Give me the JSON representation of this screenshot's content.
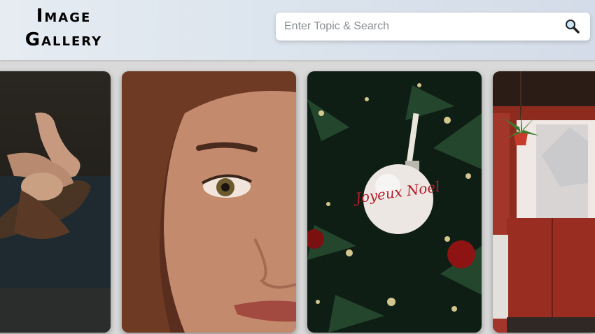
{
  "header": {
    "logo_line1": "Image",
    "logo_line2": "Gallery"
  },
  "search": {
    "placeholder": "Enter Topic & Search",
    "value": "",
    "icon": "magnifier-icon"
  },
  "gallery": {
    "images": [
      {
        "subject": "woman-lying-on-couch"
      },
      {
        "subject": "woman-face-closeup"
      },
      {
        "subject": "christmas-ornament"
      },
      {
        "subject": "red-doorway-with-plant"
      }
    ]
  },
  "ornament_text": "Joyeux Noel"
}
